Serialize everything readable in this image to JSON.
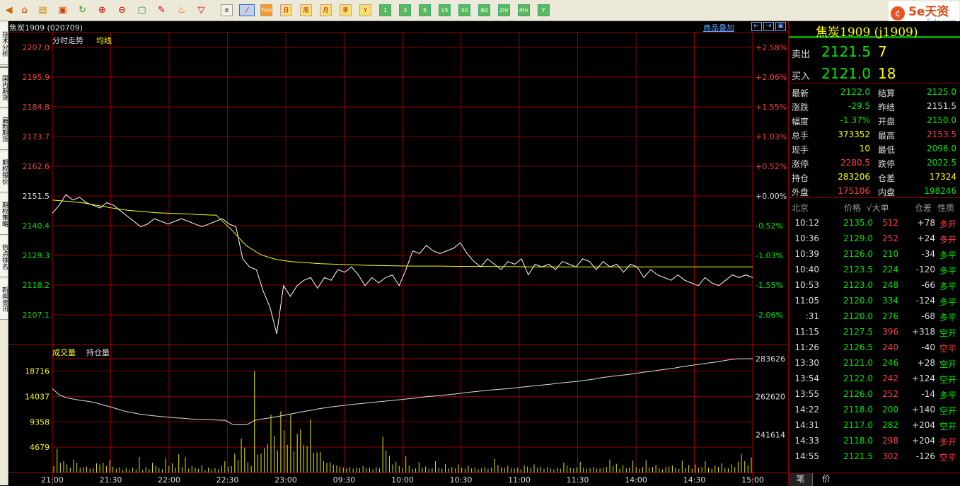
{
  "toolbar": {
    "period_buttons": [
      "Tick",
      "日",
      "周",
      "月",
      "季",
      "Y",
      "1",
      "3",
      "5",
      "15",
      "30",
      "60",
      "2hr",
      "4hr",
      "Y"
    ]
  },
  "side_tabs": [
    "技术分析",
    "国内期货",
    "最新期货",
    "期权报价",
    "期权策略",
    "热点排名",
    "新闻资讯"
  ],
  "header": {
    "instrument": "焦炭1909 (020709)",
    "overlay_link": "商品叠加",
    "chart_label": "分时走势",
    "avg_label": "均线",
    "volume_label": "成交量",
    "oi_label": "持仓量"
  },
  "price_axis": {
    "left_labels": [
      "2207.0",
      "2195.9",
      "2184.8",
      "2173.7",
      "2162.6",
      "2151.5",
      "2140.4",
      "2129.3",
      "2118.2",
      "2107.1"
    ],
    "right_labels": [
      "+2.58%",
      "+2.06%",
      "+1.55%",
      "+1.03%",
      "+0.52%",
      "+0.00%",
      "-0.52%",
      "-1.03%",
      "-1.55%",
      "-2.06%"
    ]
  },
  "volume_axis": {
    "left_labels": [
      "18716",
      "14037",
      "9358",
      "4679"
    ],
    "right_labels": [
      "283626",
      "262620",
      "241614"
    ]
  },
  "time_axis": [
    "21:00",
    "21:30",
    "22:00",
    "22:30",
    "23:00",
    "09:30",
    "10:00",
    "10:30",
    "11:00",
    "11:30",
    "14:00",
    "14:30",
    "15:00"
  ],
  "chart_data": {
    "type": "line",
    "time_labels": [
      "21:00",
      "21:30",
      "22:00",
      "22:30",
      "23:00",
      "09:30",
      "10:00",
      "10:30",
      "11:00",
      "11:30",
      "14:00",
      "14:30",
      "15:00"
    ],
    "price_ylim": [
      2096.0,
      2207.0
    ],
    "reference_price": 2151.5,
    "price": [
      2145,
      2148,
      2152,
      2150,
      2151,
      2149,
      2148,
      2147,
      2149,
      2148,
      2146,
      2144,
      2142,
      2140,
      2141,
      2143,
      2142,
      2141,
      2142,
      2143,
      2142,
      2141,
      2140,
      2141,
      2142,
      2143,
      2141,
      2140,
      2128,
      2125,
      2124,
      2116,
      2110,
      2100,
      2118,
      2114,
      2118,
      2120,
      2121,
      2117,
      2121,
      2120,
      2124,
      2123,
      2125,
      2122,
      2118,
      2121,
      2119,
      2121,
      2122,
      2118,
      2124,
      2131,
      2130,
      2133,
      2131,
      2130,
      2131,
      2132,
      2134,
      2130,
      2127,
      2125,
      2128,
      2126,
      2124,
      2127,
      2126,
      2128,
      2122,
      2126,
      2125,
      2126,
      2124,
      2127,
      2126,
      2125,
      2128,
      2127,
      2124,
      2127,
      2125,
      2126,
      2123,
      2126,
      2125,
      2121,
      2124,
      2122,
      2121,
      2120,
      2122,
      2120,
      2119,
      2118,
      2121,
      2119,
      2118,
      2120,
      2122,
      2121,
      2122,
      2121
    ],
    "average": [
      2150.0,
      2149.5,
      2149.0,
      2148.0,
      2147.0,
      2146.2,
      2145.7,
      2145.2,
      2145.0,
      2144.8,
      2144.5,
      2144.3,
      2139.0,
      2133.0,
      2129.5,
      2127.8,
      2127.0,
      2126.6,
      2126.2,
      2126.0,
      2125.8,
      2125.6,
      2125.5,
      2125.4,
      2125.3,
      2125.3,
      2125.3,
      2125.2,
      2125.2,
      2125.2,
      2125.1,
      2125.1,
      2125.0,
      2125.0,
      2125.0,
      2125.0,
      2125.0,
      2125.0,
      2125.0,
      2125.0,
      2125.0,
      2125.0,
      2125.0,
      2125.0,
      2125.0,
      2125.0,
      2125.0,
      2125.0
    ],
    "volume_ylim": [
      0,
      21000
    ],
    "volume": [
      1200,
      4400,
      1800,
      2100,
      1500,
      900,
      2400,
      1800,
      900,
      1000,
      1100,
      700,
      800,
      1700,
      1500,
      1800,
      1200,
      2300,
      1100,
      700,
      1000,
      500,
      800,
      500,
      900,
      600,
      2900,
      500,
      1000,
      600,
      1800,
      1300,
      900,
      600,
      2600,
      1200,
      1700,
      900,
      3400,
      1000,
      2800,
      700,
      1200,
      900,
      700,
      1400,
      400,
      900,
      600,
      800,
      600,
      1200,
      2100,
      1100,
      1200,
      3500,
      2300,
      6300,
      4600,
      1900,
      1200,
      18716,
      3300,
      3500,
      4500,
      5300,
      10700,
      6800,
      4100,
      11300,
      7800,
      5100,
      10700,
      3900,
      7100,
      8000,
      5100,
      4900,
      9800,
      3600,
      3700,
      3800,
      2100,
      1800,
      1900,
      1400,
      1300,
      1100,
      900,
      800,
      1000,
      700,
      900,
      800,
      1200,
      800,
      900,
      600,
      1000,
      800,
      6600,
      4100,
      3100,
      1500,
      2000,
      1200,
      900,
      3000,
      1300,
      700,
      800,
      1900,
      900,
      1100,
      700,
      800,
      2100,
      900,
      700,
      1600,
      800,
      1000,
      800,
      1500,
      900,
      700,
      1200,
      800,
      900,
      600,
      800,
      1000,
      700,
      900,
      2500,
      1400,
      1000,
      900,
      1200,
      800,
      700,
      900,
      600,
      1300,
      1100,
      800,
      1500,
      900,
      1000,
      700,
      1000,
      800,
      600,
      900,
      700,
      1800,
      1300,
      900,
      800,
      1000,
      2000,
      900,
      700,
      800,
      1000,
      700,
      800,
      900,
      1000,
      2400,
      1200,
      1600,
      700,
      1400,
      800,
      900,
      2200,
      1000,
      700,
      1000,
      2300,
      900,
      1000,
      1400,
      800,
      600,
      1000,
      1100,
      1300,
      900,
      700,
      2200,
      800,
      1400,
      700,
      1500,
      900,
      1000,
      2100,
      900,
      700,
      1300,
      1000,
      1700,
      900,
      800,
      1500,
      1000,
      2000,
      3400,
      2100,
      1400,
      2800
    ],
    "oi_ylim": [
      220608,
      283626
    ],
    "open_interest": [
      267000,
      263500,
      262000,
      261200,
      260500,
      260000,
      259200,
      258000,
      257000,
      255800,
      254600,
      253800,
      253000,
      252500,
      252000,
      251600,
      251300,
      250900,
      250700,
      250300,
      250100,
      250000,
      249800,
      249600,
      249500,
      247100,
      247000,
      247200,
      249500,
      250200,
      250800,
      251500,
      252200,
      253000,
      253800,
      254500,
      255200,
      256000,
      256500,
      257100,
      257600,
      258100,
      258500,
      258900,
      259300,
      259700,
      260100,
      260500,
      260900,
      261300,
      261700,
      262200,
      262700,
      263000,
      263400,
      263800,
      264200,
      264700,
      265200,
      265600,
      266000,
      266400,
      266700,
      267000,
      267400,
      267900,
      268300,
      268700,
      269100,
      269500,
      270000,
      270400,
      270800,
      271200,
      271800,
      272300,
      273100,
      273600,
      274100,
      274500,
      275000,
      275600,
      276200,
      276700,
      277300,
      277800,
      278300,
      279000,
      279600,
      280200,
      280700,
      281300,
      281800,
      282500,
      283200,
      283500,
      283600,
      283626
    ]
  },
  "quote": {
    "name": "焦炭1909 (j1909)",
    "ask_label": "卖出",
    "ask_price": "2121.5",
    "ask_vol": "7",
    "bid_label": "买入",
    "bid_price": "2121.0",
    "bid_vol": "18",
    "stats": [
      {
        "l1": "最新",
        "v1": "2122.0",
        "c1": "g",
        "l2": "结算",
        "v2": "2125.0",
        "c2": "g"
      },
      {
        "l1": "涨跌",
        "v1": "-29.5",
        "c1": "g",
        "l2": "昨结",
        "v2": "2151.5",
        "c2": "w"
      },
      {
        "l1": "幅度",
        "v1": "-1.37%",
        "c1": "g",
        "l2": "开盘",
        "v2": "2150.0",
        "c2": "g"
      },
      {
        "l1": "总手",
        "v1": "373352",
        "c1": "y",
        "l2": "最高",
        "v2": "2153.5",
        "c2": "r"
      },
      {
        "l1": "现手",
        "v1": "10",
        "c1": "y",
        "l2": "最低",
        "v2": "2096.0",
        "c2": "g"
      },
      {
        "l1": "涨停",
        "v1": "2280.5",
        "c1": "r",
        "l2": "跌停",
        "v2": "2022.5",
        "c2": "g"
      },
      {
        "l1": "持仓",
        "v1": "283206",
        "c1": "y",
        "l2": "仓差",
        "v2": "17324",
        "c2": "y"
      },
      {
        "l1": "外盘",
        "v1": "175106",
        "c1": "r",
        "l2": "内盘",
        "v2": "198246",
        "c2": "g"
      }
    ],
    "tick_headers": {
      "time": "北京",
      "price": "价格",
      "vol": "√大单",
      "oi": "仓差",
      "nature": "性质"
    },
    "ticks": [
      {
        "time": "10:12",
        "price": "2135.0",
        "vol": "512",
        "vc": "r",
        "oi": "+78",
        "nature": "多开",
        "nc": "r"
      },
      {
        "time": "10:36",
        "price": "2129.0",
        "vol": "252",
        "vc": "r",
        "oi": "+24",
        "nature": "多开",
        "nc": "r"
      },
      {
        "time": "10:39",
        "price": "2126.0",
        "vol": "210",
        "vc": "g",
        "oi": "-34",
        "nature": "多平",
        "nc": "g"
      },
      {
        "time": "10:40",
        "price": "2123.5",
        "vol": "224",
        "vc": "g",
        "oi": "-120",
        "nature": "多平",
        "nc": "g"
      },
      {
        "time": "10:53",
        "price": "2123.0",
        "vol": "248",
        "vc": "g",
        "oi": "-66",
        "nature": "多平",
        "nc": "g"
      },
      {
        "time": "11:05",
        "price": "2120.0",
        "vol": "334",
        "vc": "g",
        "oi": "-124",
        "nature": "多平",
        "nc": "g"
      },
      {
        "time": ":31",
        "price": "2120.0",
        "vol": "276",
        "vc": "g",
        "oi": "-68",
        "nature": "多平",
        "nc": "g"
      },
      {
        "time": "11:15",
        "price": "2127.5",
        "vol": "396",
        "vc": "r",
        "oi": "+318",
        "nature": "空开",
        "nc": "g"
      },
      {
        "time": "11:26",
        "price": "2126.5",
        "vol": "240",
        "vc": "r",
        "oi": "-40",
        "nature": "空平",
        "nc": "r"
      },
      {
        "time": "13:30",
        "price": "2121.0",
        "vol": "246",
        "vc": "g",
        "oi": "+28",
        "nature": "空开",
        "nc": "g"
      },
      {
        "time": "13:54",
        "price": "2122.0",
        "vol": "242",
        "vc": "r",
        "oi": "+124",
        "nature": "空开",
        "nc": "g"
      },
      {
        "time": "13:55",
        "price": "2126.0",
        "vol": "252",
        "vc": "r",
        "oi": "-14",
        "nature": "多平",
        "nc": "g"
      },
      {
        "time": "14:22",
        "price": "2118.0",
        "vol": "200",
        "vc": "g",
        "oi": "+140",
        "nature": "空开",
        "nc": "g"
      },
      {
        "time": "14:31",
        "price": "2117.0",
        "vol": "282",
        "vc": "g",
        "oi": "+204",
        "nature": "空开",
        "nc": "g"
      },
      {
        "time": "14:33",
        "price": "2118.0",
        "vol": "298",
        "vc": "r",
        "oi": "+204",
        "nature": "多开",
        "nc": "r"
      },
      {
        "time": "14:55",
        "price": "2121.5",
        "vol": "302",
        "vc": "r",
        "oi": "-126",
        "nature": "空平",
        "nc": "r"
      }
    ],
    "bottom_tabs": [
      "笔",
      "价"
    ]
  },
  "brand": {
    "name": "5e天资",
    "domain": "5etz.com"
  }
}
